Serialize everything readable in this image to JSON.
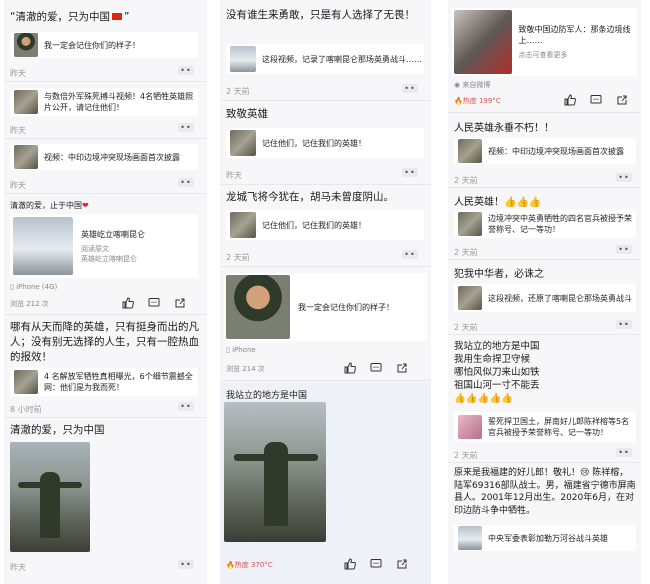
{
  "col1": {
    "h1": "“清澈的爱，只为中国",
    "h1_tail": "”",
    "card1": "我一定会记住你们的样子！",
    "time1": "昨天",
    "card2": "与数倍外军殊死搏斗视频！4名牺牲英雄照片公开，请记住他们！",
    "time2": "昨天",
    "card3": "视频：中印边境冲突现场画面首次披露",
    "time3": "昨天",
    "post_text": "清澈的爱，止于中国",
    "link_title": "英雄屹立喀喇昆仑",
    "link_sub1": "阅读原文",
    "link_sub2": "英雄屹立喀喇昆仑",
    "device": "iPhone (4G)",
    "views": "浏览 212 次",
    "h2": "哪有从天而降的英雄，只有挺身而出的凡人；没有别无选择的人生，只有一腔热血的报效！",
    "card4": "4 名解放军牺牲真相曝光，6个细节震撼全网：他们是为我而死！",
    "time4": "8 小时前",
    "h3": "清澈的爱，只为中国",
    "time5": "昨天"
  },
  "col2": {
    "h1": "没有谁生来勇敢，只是有人选择了无畏！",
    "card1": "这段视频，记录了喀喇昆仑那场英勇战斗……",
    "time1": "2 天前",
    "h2": "致敬英雄",
    "card2": "记住他们，记住我们的英雄！",
    "time2": "昨天",
    "h3": "龙城飞将今犹在，胡马未曾度阴山。",
    "card3": "记住他们，记住我们的英雄！",
    "time3": "2 天前",
    "share_text": "我一定会记住你们的样子！",
    "device": "iPhone",
    "views": "浏览 214 次",
    "h4": "我站立的地方是中国",
    "hot": "热度 370°C"
  },
  "col3": {
    "top_card": "致敬中国边防军人：那条边境线上……",
    "top_card_sub": "点击可查看更多",
    "source": "来自微博",
    "hot": "热度 199°C",
    "h1": "人民英雄永垂不朽！！",
    "card1": "视频：中印边境冲突现场画面首次披露",
    "time1": "2 天前",
    "h2": "人民英雄！👍👍👍",
    "card2": "边境冲突中英勇牺牲的四名官兵被授予荣誉称号、记一等功！",
    "time2": "2 天前",
    "h3": "犯我中华者，必诛之",
    "card3": "这段视频，还原了喀喇昆仑那场英勇战斗",
    "time3": "2 天前",
    "poem": [
      "我站立的地方是中国",
      "我用生命捍卫守候",
      "哪怕风似刀来山如铁",
      "祖国山河一寸不能丢"
    ],
    "thumbs": "👍👍👍👍👍",
    "card4": "誓死捍卫国土，屏南好儿郎陈祥榕等5名官兵被授予荣誉称号、记一等功！",
    "time4": "2 天前",
    "h4": "原来是我福建的好儿郎！敬礼！😢 陈祥榕，陆军69316部队战士。男，福建省宁德市屏南县人。2001年12月出生。2020年6月，在对印边防斗争中牺牲。",
    "card5": "中央军委表彰加勒万河谷战斗英雄"
  },
  "icons": {
    "like": "thumbs-up-icon",
    "comment": "comment-icon",
    "share": "share-icon",
    "more": "more-icon"
  },
  "colors": {
    "background": "#f7f7f9",
    "card": "#ffffff",
    "hot": "#dd5555",
    "flag": "#de2910"
  }
}
